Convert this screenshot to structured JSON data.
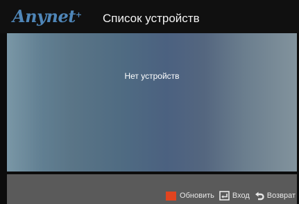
{
  "header": {
    "logo_text": "Anynet",
    "logo_plus": "+",
    "title": "Список устройств"
  },
  "device_list": {
    "empty_message": "Нет устройств"
  },
  "footer": {
    "refresh_label": "Обновить",
    "refresh_icon": "red-key-icon",
    "refresh_color": "#e2441f",
    "enter_label": "Вход",
    "enter_icon": "enter-key-icon",
    "return_label": "Возврат",
    "return_icon": "return-arrow-icon"
  }
}
